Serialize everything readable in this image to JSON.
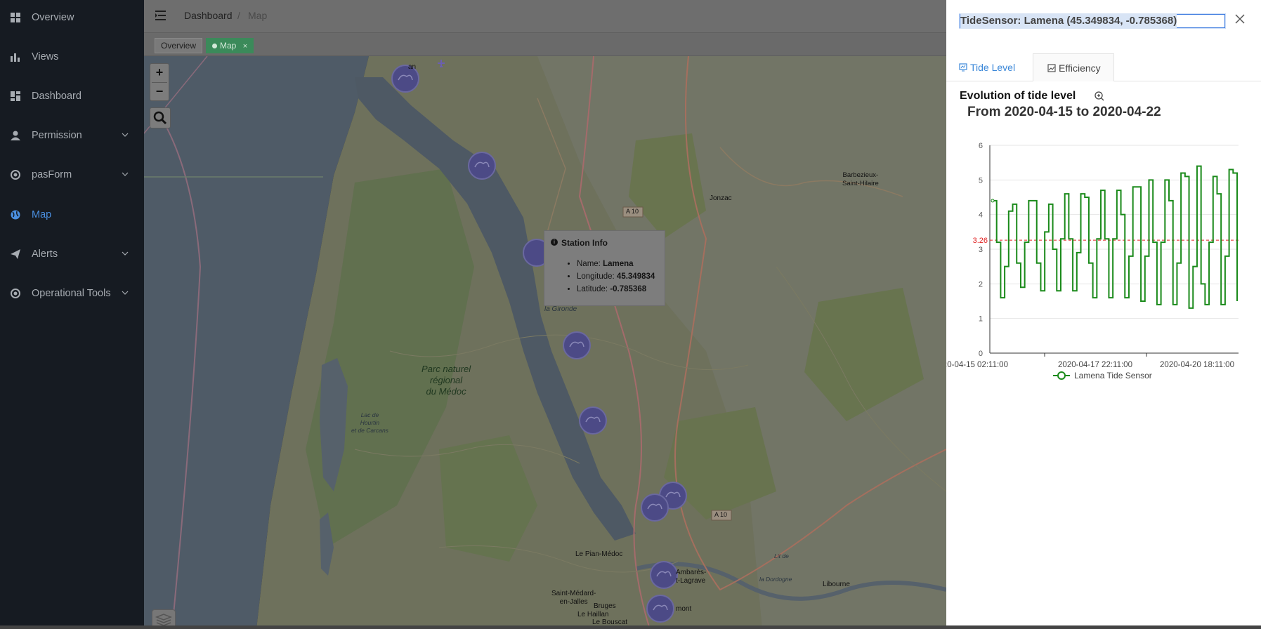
{
  "sidebar": {
    "items": [
      {
        "label": "Overview",
        "icon": "grid-icon",
        "has_submenu": false,
        "active": false
      },
      {
        "label": "Views",
        "icon": "bar-chart-icon",
        "has_submenu": false,
        "active": false
      },
      {
        "label": "Dashboard",
        "icon": "dashboard-icon",
        "has_submenu": false,
        "active": false
      },
      {
        "label": "Permission",
        "icon": "user-icon",
        "has_submenu": true,
        "active": false
      },
      {
        "label": "pasForm",
        "icon": "form-icon",
        "has_submenu": true,
        "active": false
      },
      {
        "label": "Map",
        "icon": "globe-icon",
        "has_submenu": false,
        "active": true
      },
      {
        "label": "Alerts",
        "icon": "paper-plane-icon",
        "has_submenu": true,
        "active": false
      },
      {
        "label": "Operational Tools",
        "icon": "tools-icon",
        "has_submenu": true,
        "active": false
      }
    ]
  },
  "breadcrumb": {
    "first": "Dashboard",
    "separator": "/",
    "current": "Map"
  },
  "tags": [
    {
      "label": "Overview",
      "active": false
    },
    {
      "label": "Map",
      "active": true,
      "close": "×"
    }
  ],
  "map": {
    "zoom_in": "+",
    "zoom_out": "−",
    "labels": {
      "park": [
        "Parc naturel",
        "régional",
        "du Médoc"
      ],
      "lake": [
        "Lac de",
        "Hourtin",
        "et de Carcans"
      ],
      "gironde": "la Gironde",
      "jonzac": "Jonzac",
      "barbezieux": [
        "Barbezieux-",
        "Saint-Hilaire"
      ],
      "a10_top": "A 10",
      "a10_bottom": "A 10",
      "le_pian": "Le Pian-Médoc",
      "saint_medard": [
        "Saint-Médard-",
        "en-Jalles"
      ],
      "bruges": "Bruges",
      "le_haillan": "Le Haillan",
      "le_bouscat": "Le Bouscat",
      "ambares": [
        "Ambarès-",
        "t-Lagrave"
      ],
      "libourne": "Libourne",
      "la_dordogne": "la Dordogne",
      "lit_de": "Lit de",
      "top_fragment": "an",
      "mont": "mont"
    },
    "popup": {
      "title": "Station Info",
      "name_label": "Name:",
      "name_value": "Lamena",
      "lon_label": "Longitude:",
      "lon_value": "45.349834",
      "lat_label": "Latitude:",
      "lat_value": "-0.785368"
    }
  },
  "drawer": {
    "title": "TideSensor: Lamena (45.349834, -0.785368)",
    "tabs": [
      {
        "label": "Tide Level",
        "active": true
      },
      {
        "label": "Efficiency",
        "active": false
      }
    ],
    "chart_title": "Evolution of tide level",
    "chart_subtitle": "From 2020-04-15 to 2020-04-22"
  },
  "colors": {
    "sidebar_bg": "#161b22",
    "active": "#4a8fe0",
    "series": "#1a8a1a",
    "mark_line": "#e02020"
  },
  "chart_data": {
    "type": "line",
    "x_tick_labels": [
      ":0-04-15 02:11:00",
      "2020-04-17 22:11:00",
      "2020-04-20 18:11:00"
    ],
    "ylim": [
      0,
      6
    ],
    "y_ticks": [
      0,
      1,
      2,
      3,
      4,
      5,
      6
    ],
    "series": [
      {
        "name": "Lamena Tide Sensor",
        "values": [
          4.4,
          3.2,
          1.6,
          2.5,
          4.1,
          4.3,
          2.6,
          1.9,
          3.2,
          4.4,
          4.4,
          2.6,
          1.8,
          3.5,
          4.3,
          3.0,
          1.8,
          3.3,
          4.6,
          3.3,
          1.8,
          2.9,
          4.6,
          4.5,
          2.6,
          1.6,
          3.3,
          4.7,
          3.3,
          1.6,
          3.3,
          4.7,
          4.0,
          1.6,
          2.8,
          4.8,
          4.8,
          1.5,
          2.8,
          5.0,
          3.2,
          1.4,
          3.2,
          5.0,
          4.4,
          1.4,
          2.6,
          5.2,
          5.1,
          1.3,
          2.5,
          5.4,
          2.0,
          1.4,
          3.2,
          5.1,
          4.6,
          1.4,
          2.8,
          5.3,
          5.2,
          1.5
        ]
      }
    ],
    "mark_line": {
      "label": "3.26",
      "value": 3.26
    },
    "legend": "bottom-center",
    "grid": true
  }
}
